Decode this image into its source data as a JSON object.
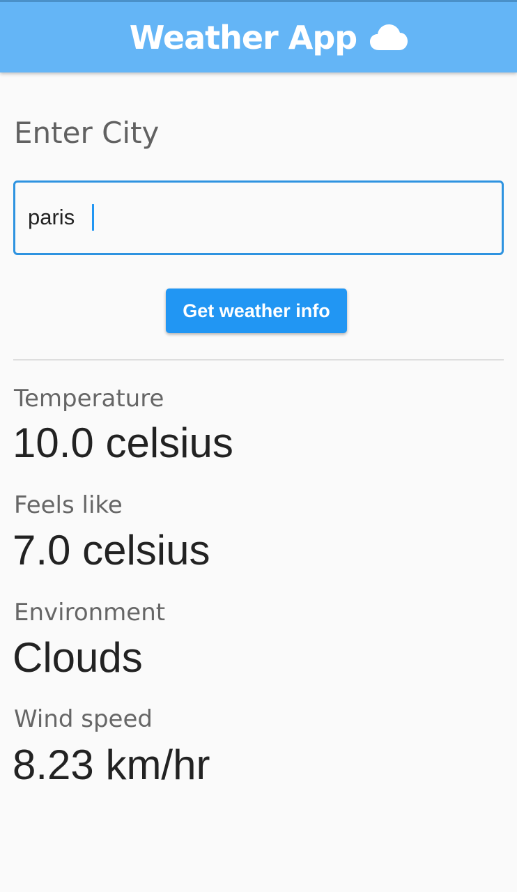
{
  "app_bar": {
    "title": "Weather App",
    "icon": "cloud-icon",
    "color": "#64b5f6"
  },
  "form": {
    "label": "Enter City",
    "city_value": "paris",
    "city_placeholder": "",
    "button_label": "Get weather info",
    "accent_color": "#2196f3"
  },
  "weather": {
    "temperature": {
      "label": "Temperature",
      "value": "10.0 celsius"
    },
    "feels_like": {
      "label": "Feels like",
      "value": "7.0 celsius"
    },
    "environment": {
      "label": "Environment",
      "value": "Clouds"
    },
    "wind_speed": {
      "label": "Wind speed",
      "value": "8.23 km/hr"
    }
  }
}
